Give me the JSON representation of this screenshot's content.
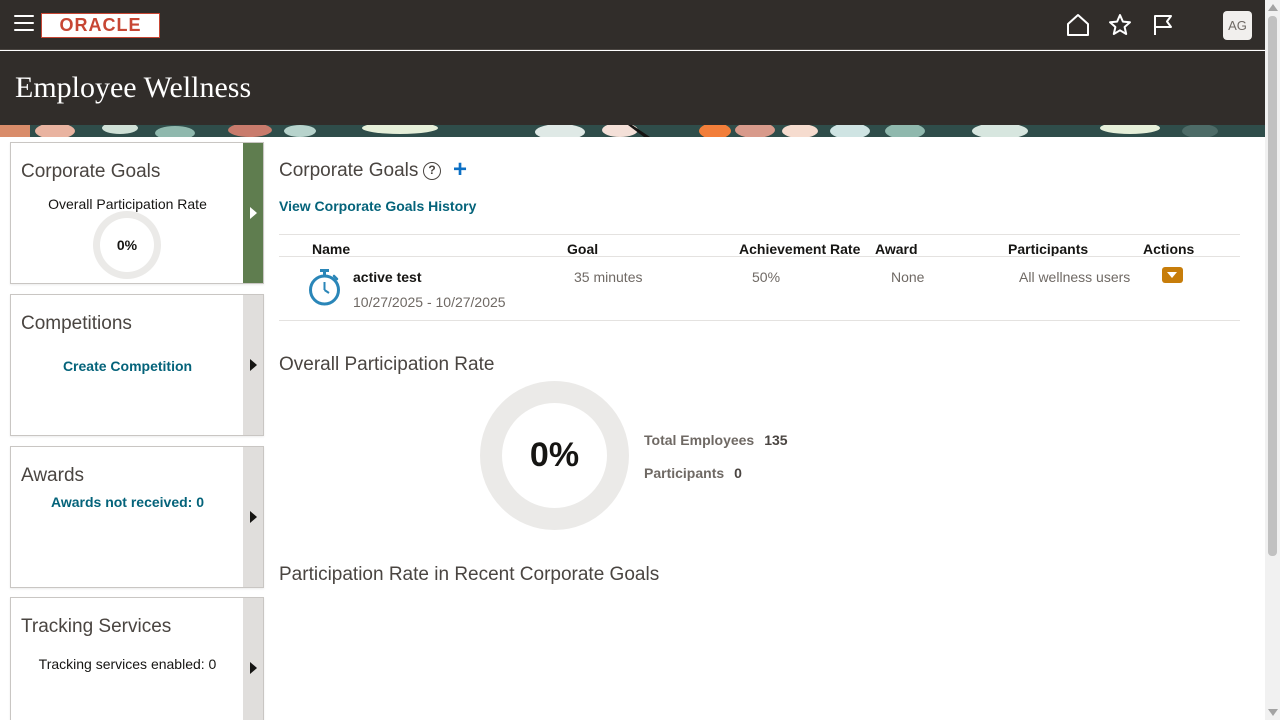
{
  "header": {
    "logo_text": "ORACLE",
    "avatar_initials": "AG",
    "page_title": "Employee Wellness"
  },
  "tiles": [
    {
      "title": "Corporate Goals",
      "subtitle": "Overall Participation Rate",
      "value": "0%"
    },
    {
      "title": "Competitions",
      "link": "Create Competition"
    },
    {
      "title": "Awards",
      "link": "Awards not received: 0"
    },
    {
      "title": "Tracking Services",
      "text": "Tracking services enabled: 0"
    }
  ],
  "main": {
    "heading": "Corporate Goals",
    "help_glyph": "?",
    "add_glyph": "+",
    "history_link": "View Corporate Goals History",
    "columns": [
      "Name",
      "Goal",
      "Achievement Rate",
      "Award",
      "Participants",
      "Actions"
    ],
    "goal": {
      "name": "active test",
      "dates": "10/27/2025 - 10/27/2025",
      "goal": "35 minutes",
      "achievement_rate": "50%",
      "award": "None",
      "participants": "All wellness users"
    },
    "participation_heading": "Overall Participation Rate",
    "participation_value": "0%",
    "total_employees_label": "Total Employees",
    "total_employees": "135",
    "participants_label": "Participants",
    "participants": "0",
    "recent_heading": "Participation Rate in Recent Corporate Goals"
  },
  "icons": {
    "menu": "hamburger-icon",
    "home": "home-icon",
    "favorites": "star-icon",
    "notifications": "flag-icon",
    "goal": "stopwatch-icon",
    "help": "help-icon",
    "add": "plus-icon"
  },
  "colors": {
    "header_bg": "#312d2a",
    "active_tile_accent": "#5f7d4f",
    "link": "#04637a",
    "add_icon": "#0b6fc4",
    "stopwatch": "#2a86b8",
    "actions_button": "#c77d0a",
    "logo_red": "#c74634"
  }
}
